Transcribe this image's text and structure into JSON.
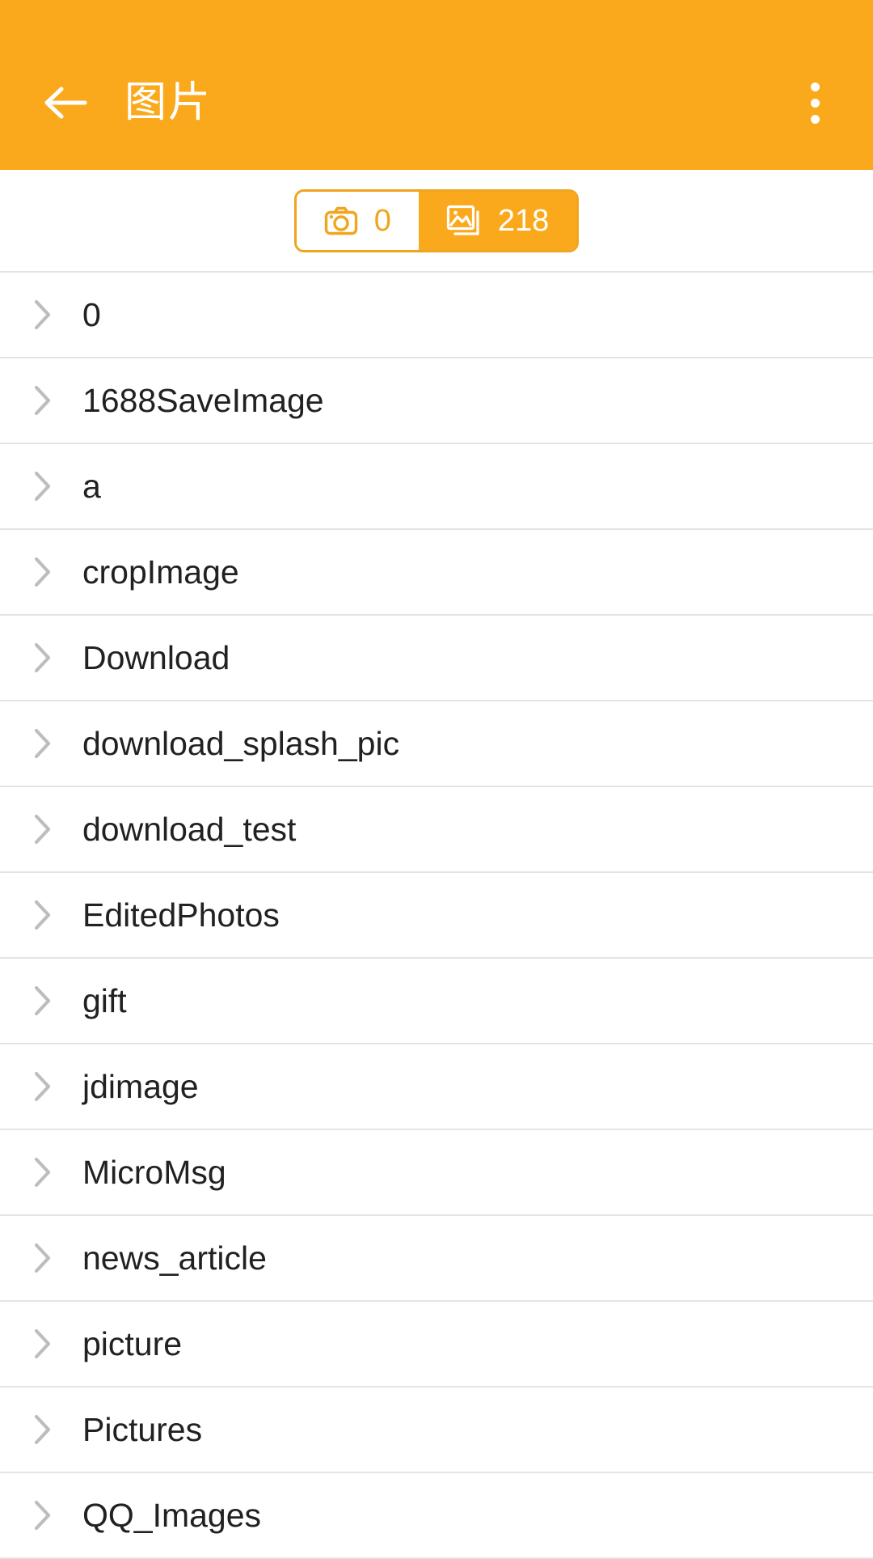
{
  "appbar": {
    "title": "图片",
    "back_icon": "arrow-left-icon",
    "overflow_icon": "more-vertical-icon",
    "background_color": "#FBA91C",
    "text_color": "#FFFFFF"
  },
  "filter_toggle": {
    "accent_color": "#F0A51E",
    "segments": [
      {
        "id": "camera",
        "icon": "camera-icon",
        "count": "0",
        "selected": false
      },
      {
        "id": "gallery",
        "icon": "photo-stack-icon",
        "count": "218",
        "selected": true
      }
    ]
  },
  "folder_list": {
    "chevron_icon": "chevron-right-icon",
    "items": [
      {
        "name": "0"
      },
      {
        "name": "1688SaveImage"
      },
      {
        "name": "a"
      },
      {
        "name": "cropImage"
      },
      {
        "name": "Download"
      },
      {
        "name": "download_splash_pic"
      },
      {
        "name": "download_test"
      },
      {
        "name": "EditedPhotos"
      },
      {
        "name": "gift"
      },
      {
        "name": "jdimage"
      },
      {
        "name": "MicroMsg"
      },
      {
        "name": "news_article"
      },
      {
        "name": "picture"
      },
      {
        "name": "Pictures"
      },
      {
        "name": "QQ_Images"
      }
    ]
  }
}
